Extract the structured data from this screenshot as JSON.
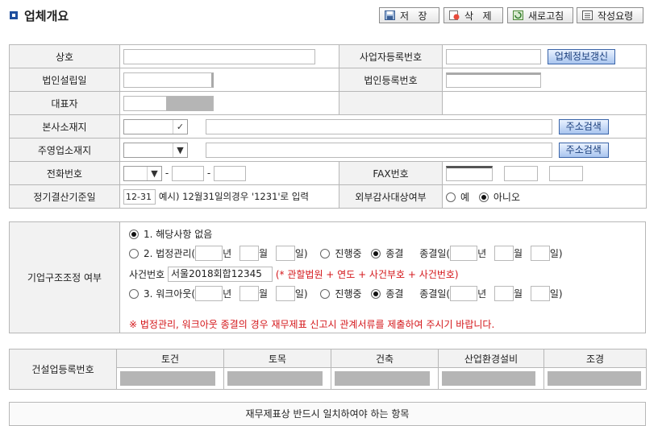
{
  "page": {
    "title": "업체개요",
    "colors": {
      "accent": "#1f4f9e",
      "label_bg": "#f2f2f2",
      "warning": "#d4171b"
    }
  },
  "toolbar": {
    "save_label": "저   장",
    "delete_label": "삭   제",
    "refresh_label": "새로고침",
    "guide_label": "작성요령",
    "icons": [
      "save-icon",
      "delete-icon",
      "refresh-icon",
      "guide-icon"
    ]
  },
  "company": {
    "name_label": "상호",
    "bizno_label": "사업자등록번호",
    "update_btn": "업체정보갱신",
    "founded_label": "법인설립일",
    "corpno_label": "법인등록번호",
    "ceo_label": "대표자",
    "hq_label": "본사소재지",
    "main_office_label": "주영업소재지",
    "addr_search_btn": "주소검색",
    "phone_label": "전화번호",
    "fax_label": "FAX번호",
    "dash": "-",
    "closing_label": "정기결산기준일",
    "closing_value": "12-31",
    "closing_hint": "예시) 12월31일의경우 '1231'로 입력",
    "audit_label": "외부감사대상여부",
    "audit_yes": "예",
    "audit_no": "아니오"
  },
  "restructuring": {
    "label": "기업구조조정 여부",
    "opt1": "1. 해당사항 없음",
    "opt2": "2. 법정관리(",
    "opt3": "3. 워크아웃(",
    "year": "년",
    "month": "월",
    "day": "일)",
    "in_progress": "진행중",
    "ended": "종결",
    "end_date": "종결일(",
    "case_no_label": "사건번호",
    "case_no_value": "서울2018회합12345",
    "case_no_hint": "(* 관할법원 + 연도 + 사건부호 + 사건번호)",
    "warning": "※ 법정관리, 워크아웃 종결의 경우 재무제표 신고시 관계서류를 제출하여 주시기 바랍니다."
  },
  "construction": {
    "label": "건설업등록번호",
    "columns": [
      "토건",
      "토목",
      "건축",
      "산업환경설비",
      "조경"
    ]
  },
  "footer": {
    "must_match": "재무제표상 반드시 일치하여야 하는 항목"
  }
}
